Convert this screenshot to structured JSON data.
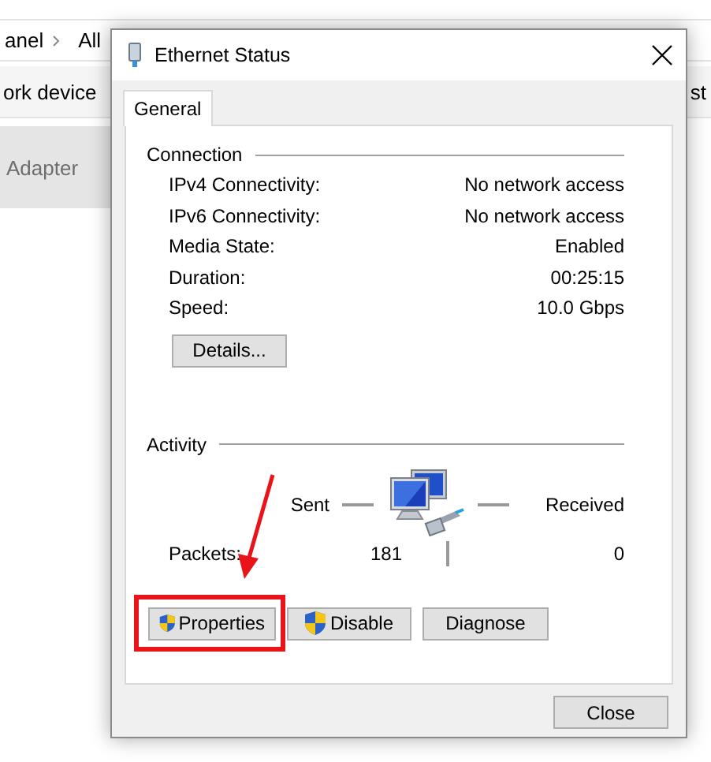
{
  "background_window": {
    "breadcrumb": [
      "anel",
      "All"
    ],
    "toolbar": [
      "ork device",
      "st"
    ],
    "list_item": "Adapter"
  },
  "dialog": {
    "title": "Ethernet Status",
    "tabs": [
      {
        "label": "General",
        "selected": true
      }
    ],
    "connection": {
      "heading": "Connection",
      "rows": [
        {
          "label": "IPv4 Connectivity:",
          "value": "No network access"
        },
        {
          "label": "IPv6 Connectivity:",
          "value": "No network access"
        },
        {
          "label": "Media State:",
          "value": "Enabled"
        },
        {
          "label": "Duration:",
          "value": "00:25:15"
        },
        {
          "label": "Speed:",
          "value": "10.0 Gbps"
        }
      ],
      "details_button": "Details..."
    },
    "activity": {
      "heading": "Activity",
      "sent_label": "Sent",
      "received_label": "Received",
      "packets_label": "Packets:",
      "sent": "181",
      "received": "0"
    },
    "buttons": [
      {
        "label": "Properties",
        "shield": true,
        "highlighted": true
      },
      {
        "label": "Disable",
        "shield": true,
        "highlighted": false
      },
      {
        "label": "Diagnose",
        "shield": false,
        "highlighted": false
      }
    ],
    "close_button": "Close"
  }
}
